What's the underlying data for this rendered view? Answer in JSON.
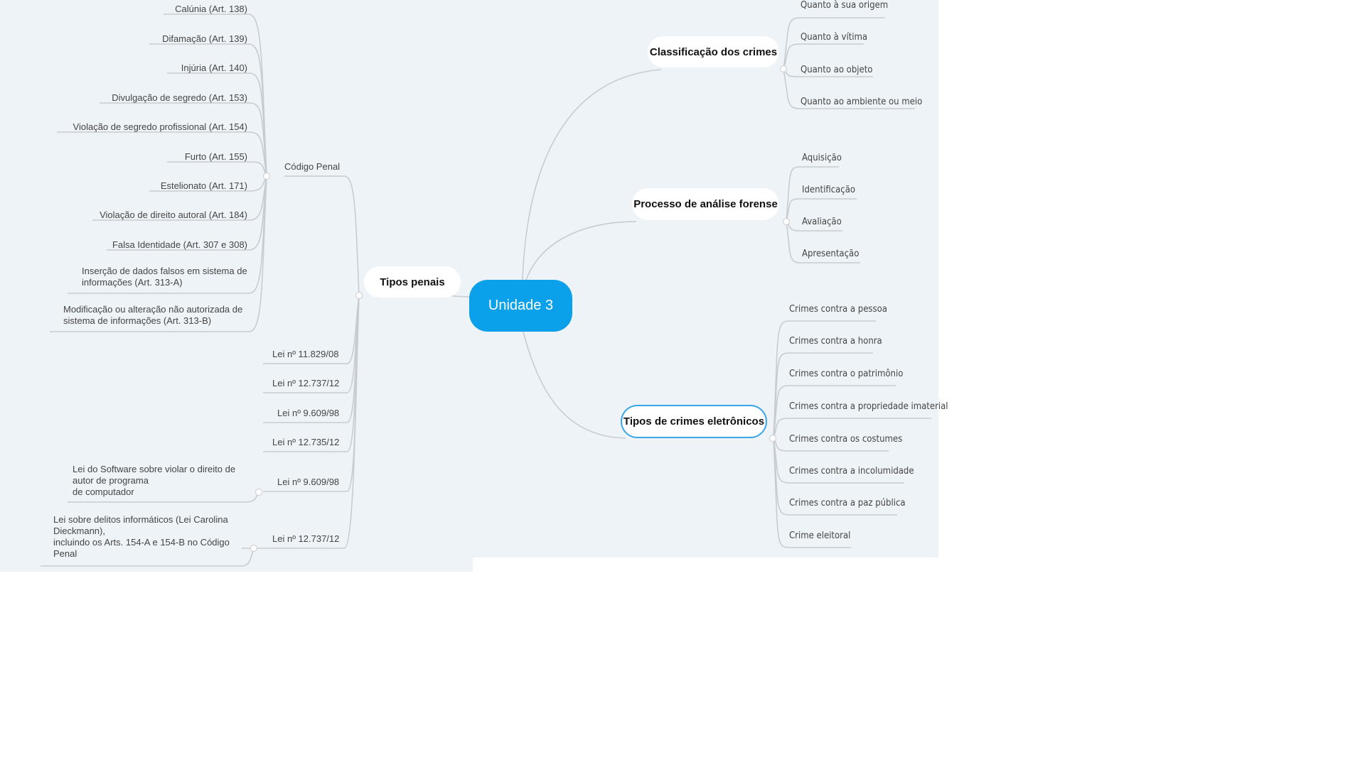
{
  "central": "Unidade 3",
  "tipos_penais": {
    "label": "Tipos penais",
    "codigo_penal": {
      "label": "Código Penal",
      "items": [
        "Calúnia (Art. 138)",
        "Difamação (Art. 139)",
        "Injúria (Art. 140)",
        "Divulgação de segredo (Art. 153)",
        "Violação de segredo profissional (Art. 154)",
        "Furto (Art. 155)",
        "Estelionato (Art. 171)",
        "Violação de direito autoral (Art. 184)",
        "Falsa Identidade (Art. 307 e 308)",
        "Inserção de dados falsos em sistema de\ninformações (Art. 313-A)",
        "Modificação ou alteração não autorizada de\nsistema de informações (Art. 313-B)"
      ]
    },
    "leis": [
      "Lei nº 11.829/08",
      "Lei nº 12.737/12",
      "Lei nº 9.609/98",
      "Lei nº 12.735/12"
    ],
    "lei_software": {
      "label": "Lei nº 9.609/98",
      "child": "Lei do Software sobre violar o direito de\nautor de programa\nde computador"
    },
    "lei_dieckmann": {
      "label": "Lei nº 12.737/12",
      "child": "Lei sobre delitos informáticos (Lei Carolina\nDieckmann),\nincluindo os Arts. 154-A e 154-B no Código\nPenal"
    }
  },
  "classificacao": {
    "label": "Classificação dos crimes",
    "items": [
      "Quanto à sua origem",
      "Quanto à vítima",
      "Quanto ao objeto",
      "Quanto ao ambiente ou meio"
    ]
  },
  "processo": {
    "label": "Processo de análise forense",
    "items": [
      "Aquisição",
      "Identificação",
      "Avaliação",
      "Apresentação"
    ]
  },
  "tipos_crimes": {
    "label": "Tipos de crimes eletrônicos",
    "items": [
      "Crimes contra a pessoa",
      "Crimes contra a honra",
      "Crimes contra o patrimônio",
      "Crimes contra a propriedade imaterial",
      "Crimes contra os costumes",
      "Crimes contra a incolumidade",
      "Crimes contra a paz pública",
      "Crime eleitoral"
    ]
  },
  "colors": {
    "central": "#0aa0ea",
    "line": "#c8ccd0",
    "background": "#eef3f7",
    "selection": "#3aa6e8"
  }
}
